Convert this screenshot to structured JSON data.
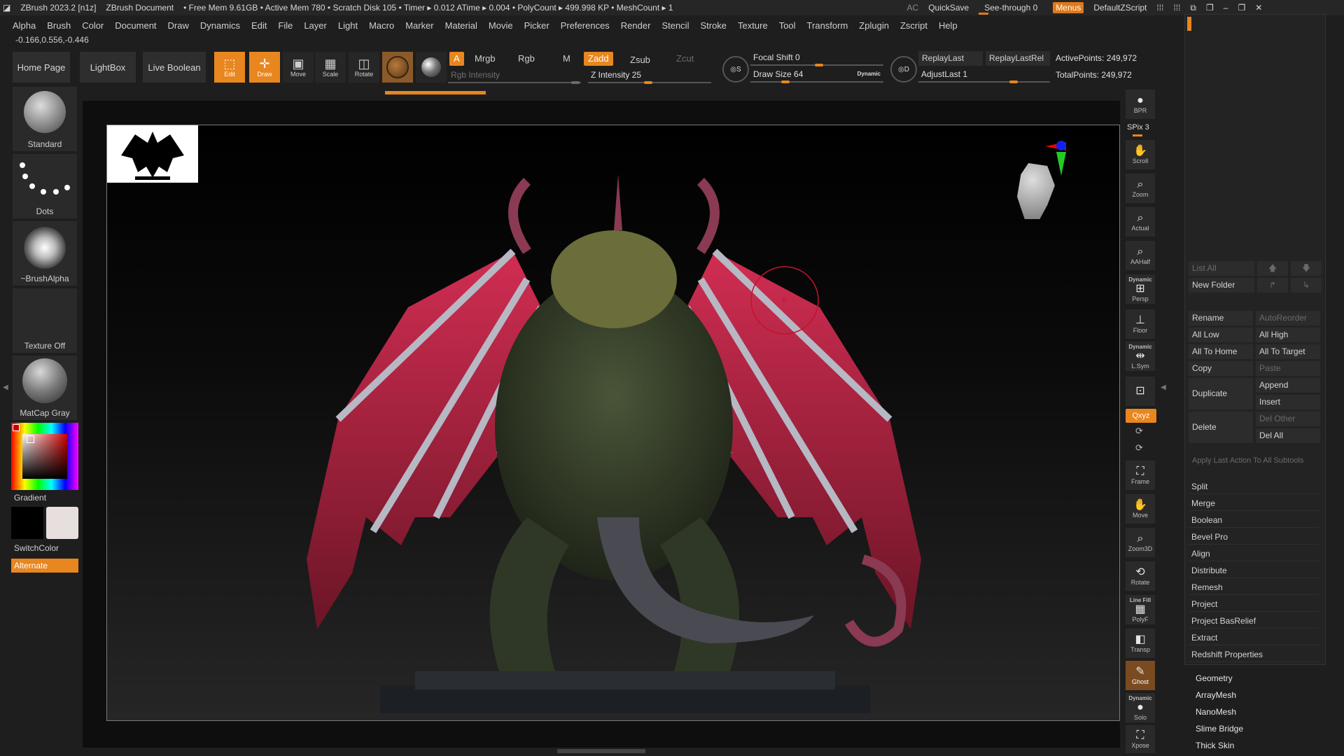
{
  "titlebar": {
    "app": "ZBrush 2023.2 [n1z]",
    "document": "ZBrush Document",
    "mem": "• Free Mem 9.61GB • Active Mem 780 • Scratch Disk 105 • Timer ▸ 0.012 ATime ▸ 0.004 • PolyCount ▸ 499.998 KP • MeshCount ▸ 1",
    "ac": "AC",
    "quicksave": "QuickSave",
    "see_through": "See-through",
    "see_through_value": "0",
    "menus": "Menus",
    "script": "DefaultZScript"
  },
  "menu": [
    "Alpha",
    "Brush",
    "Color",
    "Document",
    "Draw",
    "Dynamics",
    "Edit",
    "File",
    "Layer",
    "Light",
    "Macro",
    "Marker",
    "Material",
    "Movie",
    "Picker",
    "Preferences",
    "Render",
    "Stencil",
    "Stroke",
    "Texture",
    "Tool",
    "Transform",
    "Zplugin",
    "Zscript",
    "Help"
  ],
  "coords": "-0.166,0.556,-0.446",
  "toolbar": {
    "home": "Home Page",
    "lightbox": "LightBox",
    "live_boolean": "Live Boolean",
    "edit": "Edit",
    "draw": "Draw",
    "move": "Move",
    "scale": "Scale",
    "rotate": "Rotate",
    "a": "A",
    "mrgb": "Mrgb",
    "rgb": "Rgb",
    "m": "M",
    "zadd": "Zadd",
    "zsub": "Zsub",
    "zcut": "Zcut",
    "rgb_intensity": "Rgb Intensity",
    "z_intensity": "Z Intensity 25",
    "focal_shift": "Focal Shift 0",
    "draw_size": "Draw Size 64",
    "dynamic": "Dynamic",
    "s": "S",
    "d": "D",
    "replay_last": "ReplayLast",
    "replay_last_rel": "ReplayLastRel",
    "adjust_last": "AdjustLast 1",
    "active_points": "ActivePoints: 249,972",
    "total_points": "TotalPoints: 249,972"
  },
  "left": {
    "standard": "Standard",
    "dots": "Dots",
    "brush_alpha": "~BrushAlpha",
    "texture_off": "Texture Off",
    "matcap": "MatCap Gray",
    "gradient": "Gradient",
    "switch_color": "SwitchColor",
    "alternate": "Alternate"
  },
  "right_tools": {
    "bpr": "BPR",
    "spix": "SPix 3",
    "scroll": "Scroll",
    "zoom": "Zoom",
    "actual": "Actual",
    "aahalf": "AAHalf",
    "dynamic": "Dynamic",
    "persp": "Persp",
    "floor": "Floor",
    "lsym": "L.Sym",
    "xyz": "Qxyz",
    "frame": "Frame",
    "move": "Move",
    "zoom3d": "Zoom3D",
    "rotate": "Rotate",
    "line_fill": "Line Fill",
    "polyf": "PolyF",
    "transp": "Transp",
    "ghost": "Ghost",
    "solo": "Solo",
    "xpose": "Xpose"
  },
  "panel": {
    "list_all": "List All",
    "new_folder": "New Folder",
    "rename": "Rename",
    "auto_reorder": "AutoReorder",
    "all_low": "All Low",
    "all_high": "All High",
    "all_to_home": "All To Home",
    "all_to_target": "All To Target",
    "copy": "Copy",
    "paste": "Paste",
    "duplicate": "Duplicate",
    "append": "Append",
    "insert": "Insert",
    "delete": "Delete",
    "del_other": "Del Other",
    "del_all": "Del All",
    "apply_last": "Apply Last Action To All Subtools",
    "items": [
      "Split",
      "Merge",
      "Boolean",
      "Bevel Pro",
      "Align",
      "Distribute",
      "Remesh",
      "Project",
      "Project BasRelief",
      "Extract",
      "Redshift Properties"
    ],
    "subpalettes": [
      "Geometry",
      "ArrayMesh",
      "NanoMesh",
      "Slime Bridge",
      "Thick Skin"
    ]
  },
  "colors": {
    "accent": "#e8861f",
    "wing": "#b0253f",
    "body": "#3f4a33",
    "horns": "#8a3a52"
  }
}
